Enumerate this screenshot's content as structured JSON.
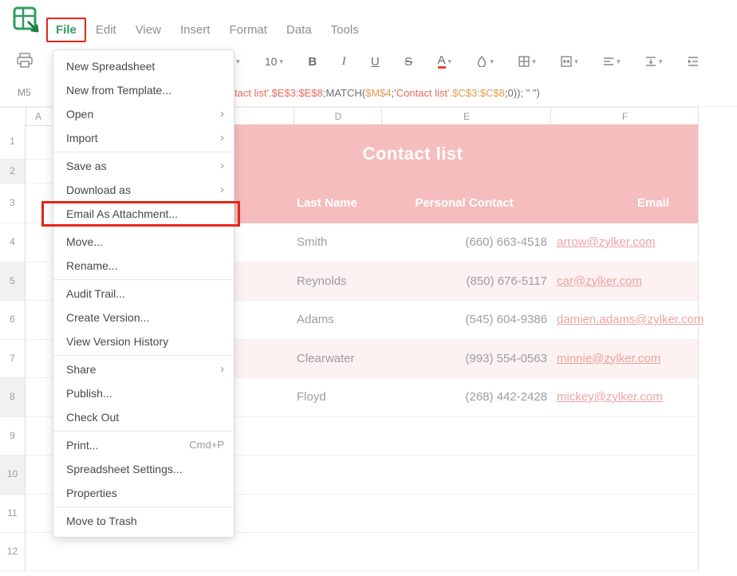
{
  "colors": {
    "accent_green": "#2f9e60",
    "annotation_red": "#e2261c",
    "band_pink": "#f5bdbd",
    "stripe_pink": "#fdf1f1",
    "link_pink": "#efa3a3",
    "formula_red": "#e8695c",
    "formula_orange": "#e39b4e"
  },
  "menubar": {
    "items": [
      {
        "label": "File",
        "active": true,
        "annotated": true
      },
      {
        "label": "Edit"
      },
      {
        "label": "View"
      },
      {
        "label": "Insert"
      },
      {
        "label": "Format"
      },
      {
        "label": "Data"
      },
      {
        "label": "Tools"
      }
    ]
  },
  "toolbar": {
    "print_button": {
      "icon": "printer-icon"
    },
    "items": [
      {
        "name": "font-family-chevron",
        "type": "chevron"
      },
      {
        "name": "font-size-select",
        "type": "text-dropdown",
        "label": "10",
        "style": "size"
      },
      {
        "name": "bold-button",
        "type": "text",
        "label": "B",
        "style": "bold"
      },
      {
        "name": "italic-button",
        "type": "text",
        "label": "I",
        "style": "italic"
      },
      {
        "name": "underline-button",
        "type": "text",
        "label": "U",
        "style": "underline"
      },
      {
        "name": "strikethrough-button",
        "type": "text",
        "label": "S",
        "style": "strike"
      },
      {
        "name": "text-color-button",
        "type": "text-dropdown",
        "label": "A",
        "style": "acolor"
      },
      {
        "name": "fill-color-button",
        "type": "icon-dropdown",
        "icon": "fill-icon"
      },
      {
        "name": "borders-button",
        "type": "icon-dropdown",
        "icon": "borders-icon"
      },
      {
        "name": "merge-cells-button",
        "type": "icon-dropdown",
        "icon": "merge-icon"
      },
      {
        "name": "horizontal-align-button",
        "type": "icon-dropdown",
        "icon": "align-icon"
      },
      {
        "name": "vertical-align-button",
        "type": "icon-dropdown",
        "icon": "valign-icon"
      },
      {
        "name": "indent-button",
        "type": "icon",
        "icon": "indent-icon"
      }
    ]
  },
  "formula_bar": {
    "cell_ref": "M5",
    "segments": [
      {
        "text": "tact list'.$E$3:$E$8",
        "color": "red"
      },
      {
        "text": ";MATCH(",
        "color": "plain"
      },
      {
        "text": "$M$4",
        "color": "orange"
      },
      {
        "text": ";",
        "color": "plain"
      },
      {
        "text": "'Contact list'",
        "color": "red"
      },
      {
        "text": ".$C$3:$C$8",
        "color": "orange"
      },
      {
        "text": ";0)); \" \")",
        "color": "plain"
      }
    ]
  },
  "column_headers": [
    "A",
    "D",
    "E",
    "F"
  ],
  "row_headers": [
    "1",
    "2",
    "3",
    "4",
    "5",
    "6",
    "7",
    "8",
    "9",
    "10",
    "11",
    "12"
  ],
  "sheet": {
    "title": "Contact list",
    "headers": [
      "Last Name",
      "Personal Contact",
      "Email"
    ],
    "rows": [
      {
        "last_name": "Smith",
        "phone": "(660) 663-4518",
        "email": "arrow@zylker.com"
      },
      {
        "last_name": "Reynolds",
        "phone": "(850) 676-5117",
        "email": "car@zylker.com"
      },
      {
        "last_name": "Adams",
        "phone": "(545) 604-9386",
        "email": "damien.adams@zylker.com"
      },
      {
        "last_name": "Clearwater",
        "phone": "(993) 554-0563",
        "email": "minnie@zylker.com"
      },
      {
        "last_name": "Floyd",
        "phone": "(268) 442-2428",
        "email": "mickey@zylker.com"
      }
    ]
  },
  "file_menu": {
    "groups": [
      [
        {
          "label": "New Spreadsheet"
        },
        {
          "label": "New from Template..."
        },
        {
          "label": "Open",
          "submenu": true
        },
        {
          "label": "Import",
          "submenu": true
        }
      ],
      [
        {
          "label": "Save as",
          "submenu": true
        },
        {
          "label": "Download as",
          "submenu": true
        },
        {
          "label": "Email As Attachment...",
          "highlighted": true
        }
      ],
      [
        {
          "label": "Move..."
        },
        {
          "label": "Rename..."
        }
      ],
      [
        {
          "label": "Audit Trail..."
        },
        {
          "label": "Create Version..."
        },
        {
          "label": "View Version History"
        }
      ],
      [
        {
          "label": "Share",
          "submenu": true
        },
        {
          "label": "Publish..."
        },
        {
          "label": "Check Out"
        }
      ],
      [
        {
          "label": "Print...",
          "shortcut": "Cmd+P"
        },
        {
          "label": "Spreadsheet Settings..."
        },
        {
          "label": "Properties"
        }
      ],
      [
        {
          "label": "Move to Trash"
        }
      ]
    ]
  }
}
